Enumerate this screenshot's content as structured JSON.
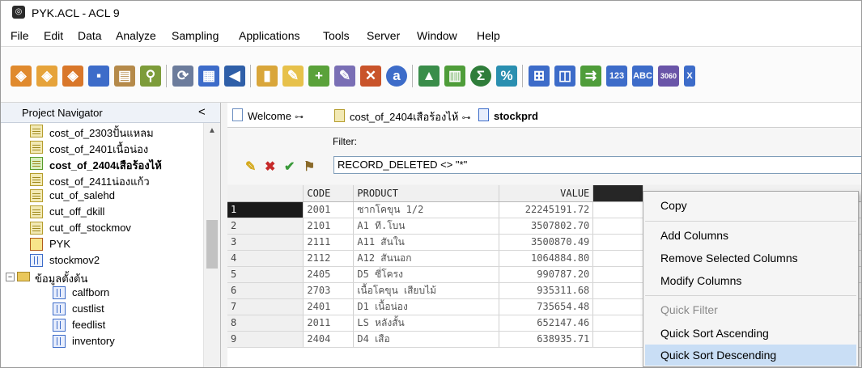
{
  "window": {
    "title": "PYK.ACL - ACL 9",
    "app_icon": "acl-app-icon"
  },
  "menu": [
    "File",
    "Edit",
    "Data",
    "Analyze",
    "Sampling",
    "Applications",
    "Tools",
    "Server",
    "Window",
    "Help"
  ],
  "toolbar": {
    "icons": [
      "open-project-icon",
      "open-table-icon",
      "import-icon",
      "save-icon",
      "print-icon",
      "find-icon",
      "refresh-icon",
      "table-layout-icon",
      "flag-icon",
      "notes-icon",
      "edit-command-icon",
      "add-record-icon",
      "edit-record-icon",
      "delete-record-icon",
      "script-icon",
      "chart-icon",
      "histogram-icon",
      "statistics-icon",
      "percent-icon",
      "summarize-icon",
      "merge-icon",
      "join-icon",
      "numeric-sort-icon",
      "alpha-sort-icon",
      "benford-icon"
    ],
    "partial_label": "X"
  },
  "navigator": {
    "title": "Project Navigator",
    "collapse": "<",
    "items": [
      {
        "label": "cost_of_2303ปั้นแหลม",
        "icon": "table-icon",
        "bold": false,
        "indent": 0
      },
      {
        "label": "cost_of_2401เนื้อน่อง",
        "icon": "table-icon",
        "bold": false,
        "indent": 0
      },
      {
        "label": "cost_of_2404เสือร้องไห้",
        "icon": "table-open-icon",
        "bold": true,
        "indent": 0
      },
      {
        "label": "cost_of_2411น่องแก้ว",
        "icon": "table-icon",
        "bold": false,
        "indent": 0
      },
      {
        "label": "cut_of_salehd",
        "icon": "table-icon",
        "bold": false,
        "indent": 0
      },
      {
        "label": "cut_off_dkill",
        "icon": "table-icon",
        "bold": false,
        "indent": 0
      },
      {
        "label": "cut_off_stockmov",
        "icon": "table-icon",
        "bold": false,
        "indent": 0
      },
      {
        "label": "PYK",
        "icon": "script-icon",
        "bold": false,
        "indent": 0
      },
      {
        "label": "stockmov2",
        "icon": "grid-table-icon",
        "bold": false,
        "indent": 0
      },
      {
        "label": "ข้อมูลตั้งต้น",
        "icon": "folder-icon",
        "bold": false,
        "indent": 0
      },
      {
        "label": "calfborn",
        "icon": "grid-table-icon",
        "bold": false,
        "indent": 1
      },
      {
        "label": "custlist",
        "icon": "grid-table-icon",
        "bold": false,
        "indent": 1
      },
      {
        "label": "feedlist",
        "icon": "grid-table-icon",
        "bold": false,
        "indent": 1
      },
      {
        "label": "inventory",
        "icon": "grid-table-icon",
        "bold": false,
        "indent": 1
      }
    ]
  },
  "tabs": [
    {
      "label": "Welcome",
      "icon": "document-icon",
      "pin": "⊶"
    },
    {
      "label": "cost_of_2404เสือร้องไห้",
      "icon": "table-icon",
      "pin": "⊶"
    },
    {
      "label": "stockprd",
      "icon": "grid-table-icon",
      "active": true
    }
  ],
  "filter": {
    "label": "Filter:",
    "value": "RECORD_DELETED <> \"*\""
  },
  "grid": {
    "columns": [
      "CODE",
      "PRODUCT",
      "VALUE"
    ],
    "rows": [
      {
        "n": "1",
        "code": "2001",
        "product": "ซากโคขุน 1/2",
        "value": "22245191.72"
      },
      {
        "n": "2",
        "code": "2101",
        "product": "A1 ที.โบน",
        "value": "3507802.70"
      },
      {
        "n": "3",
        "code": "2111",
        "product": "A11 สันใน",
        "value": "3500870.49"
      },
      {
        "n": "4",
        "code": "2112",
        "product": "A12 สันนอก",
        "value": "1064884.80"
      },
      {
        "n": "5",
        "code": "2405",
        "product": "D5 ซี่โครง",
        "value": "990787.20"
      },
      {
        "n": "6",
        "code": "2703",
        "product": "เนื้อโคขุน เสียบไม้",
        "value": "935311.68"
      },
      {
        "n": "7",
        "code": "2401",
        "product": "D1 เนื้อน่อง",
        "value": "735654.48"
      },
      {
        "n": "8",
        "code": "2011",
        "product": "LS หลังสั้น",
        "value": "652147.46"
      },
      {
        "n": "9",
        "code": "2404",
        "product": "D4 เสือ",
        "value": "638935.71"
      }
    ]
  },
  "context_menu": {
    "items": [
      {
        "label": "Copy",
        "disabled": false
      },
      {
        "label": "Add Columns",
        "disabled": false
      },
      {
        "label": "Remove Selected Columns",
        "disabled": false
      },
      {
        "label": "Modify Columns",
        "disabled": false
      },
      {
        "label": "Quick Filter",
        "disabled": true
      },
      {
        "label": "Quick Sort Ascending",
        "disabled": false
      },
      {
        "label": "Quick Sort Descending",
        "disabled": false,
        "highlighted": true
      }
    ]
  }
}
